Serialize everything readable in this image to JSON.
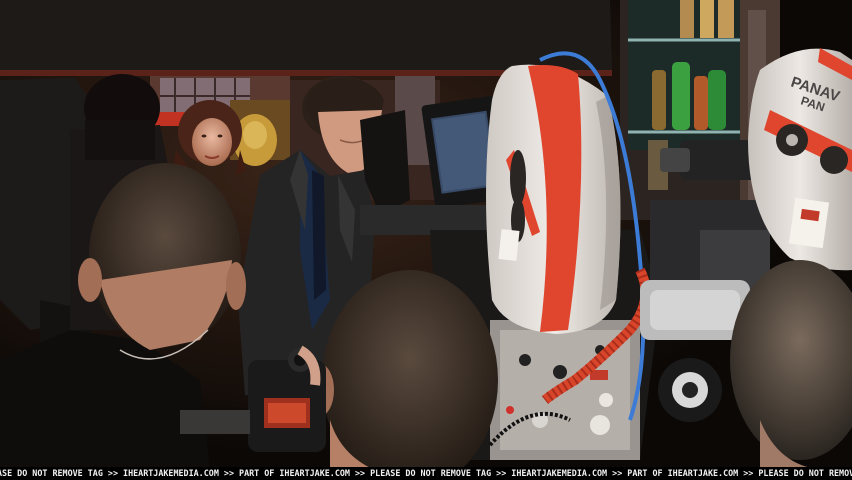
{
  "scene": {
    "description_labels": {
      "camera_brand": "PANAV",
      "camera_brand_second_line": "PAN"
    }
  },
  "watermark": {
    "text": "ASE DO NOT REMOVE TAG >> IHEARTJAKEMEDIA.COM >> PART OF IHEARTJAKE.COM >> PLEASE DO NOT REMOVE TAG >> IHEARTJAKEMEDIA.COM >> PART OF IHEARTJAKE.COM >> PLEASE DO NOT REMOVE TAG >> IHEARTJAKE"
  },
  "colors": {
    "reel_stripe": "#e0452e",
    "cable": "#d8452a",
    "blue_cable": "#3c7bd6"
  }
}
